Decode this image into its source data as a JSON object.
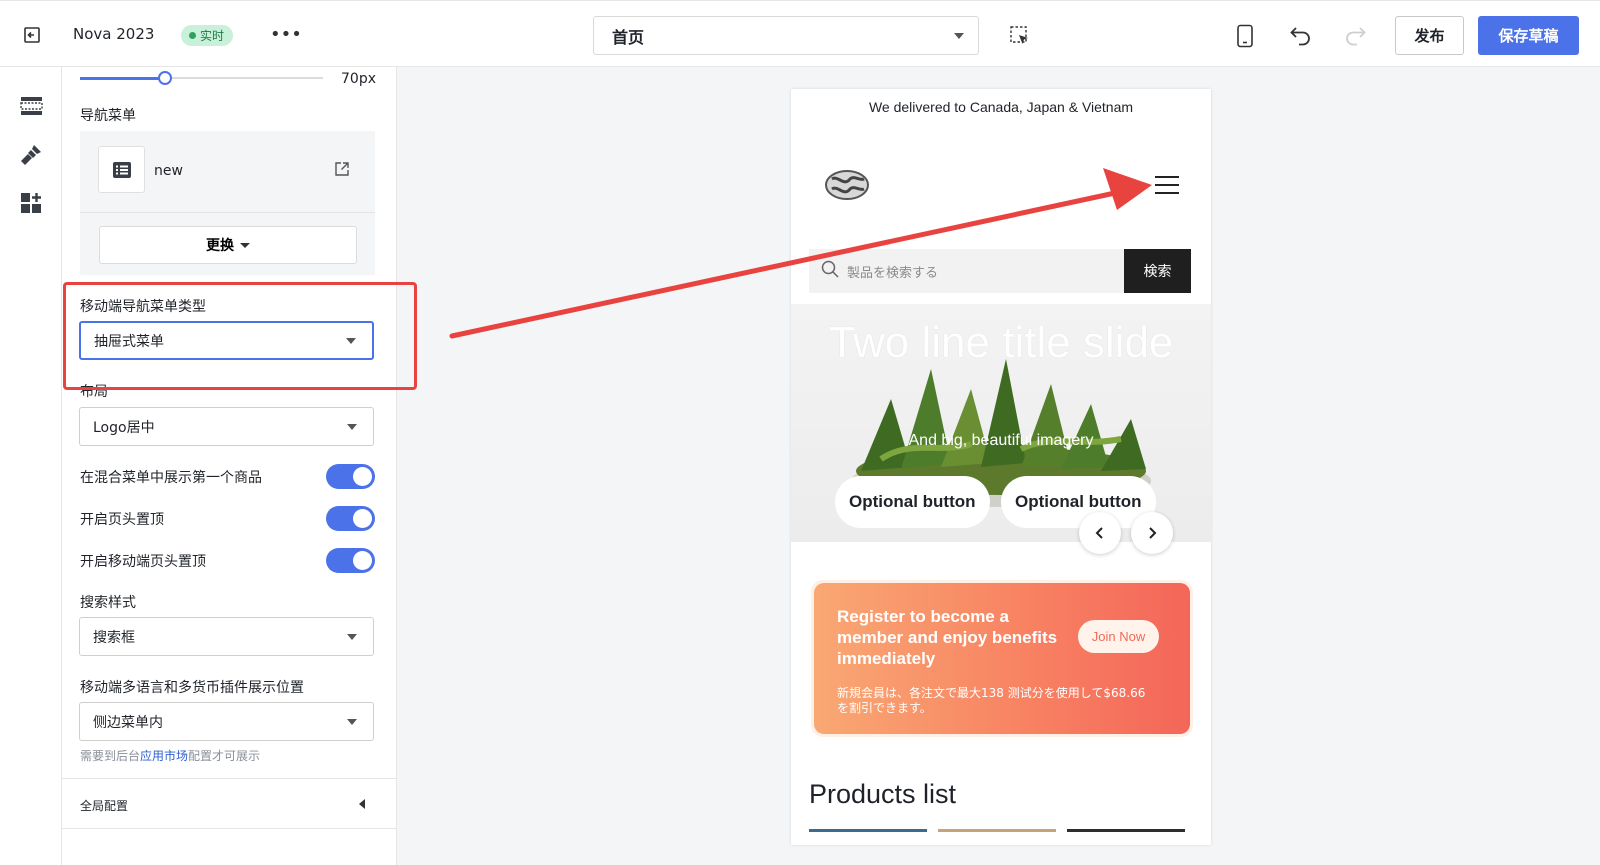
{
  "header": {
    "app_name": "Nova 2023",
    "live_badge": "实时",
    "page_select_value": "首页",
    "publish_label": "发布",
    "save_draft_label": "保存草稿"
  },
  "rail": {
    "icons": [
      "sections-icon",
      "theme-brush-icon",
      "apps-icon"
    ]
  },
  "panel": {
    "slider_value": "70px",
    "nav_menu_label": "导航菜单",
    "nav_menu_name": "new",
    "replace_label": "更换",
    "mobile_menu_type_label": "移动端导航菜单类型",
    "mobile_menu_type_value": "抽屉式菜单",
    "layout_label": "布局",
    "layout_value": "Logo居中",
    "toggles": [
      {
        "label": "在混合菜单中展示第一个商品",
        "on": true
      },
      {
        "label": "开启页头置顶",
        "on": true
      },
      {
        "label": "开启移动端页头置顶",
        "on": true
      }
    ],
    "search_style_label": "搜索样式",
    "search_style_value": "搜索框",
    "plugin_position_label": "移动端多语言和多货币插件展示位置",
    "plugin_position_value": "侧边菜单内",
    "hint_prefix": "需要到后台",
    "hint_link": "应用市场",
    "hint_suffix": "配置才可展示",
    "global_config_label": "全局配置"
  },
  "preview": {
    "announcement": "We delivered to Canada, Japan & Vietnam",
    "search_placeholder": "製品を検索する",
    "search_button": "検索",
    "hero_title": "Two line title slide",
    "hero_subtitle": "And big, beautiful imagery",
    "hero_buttons": [
      "Optional button",
      "Optional button"
    ],
    "promo_title": "Register to become a member and enjoy benefits immediately",
    "promo_join": "Join Now",
    "promo_desc": "新規会員は、各注文で最大138 测试分を使用して$68.66を割引できます。",
    "products_title": "Products list"
  },
  "colors": {
    "accent": "#4b72e8",
    "annotation_red": "#e8433f",
    "live_green": "#2ea160"
  }
}
